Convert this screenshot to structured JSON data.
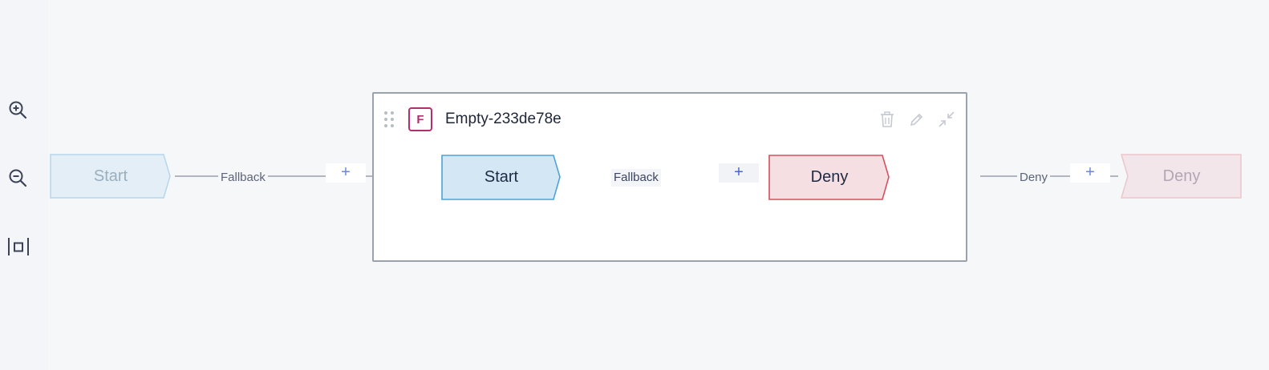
{
  "toolbar": {
    "zoom_in_icon": "zoom-in-icon",
    "zoom_out_icon": "zoom-out-icon",
    "fit_icon": "fit-to-screen-icon"
  },
  "outer_flow": {
    "start_label": "Start",
    "fallback_label": "Fallback",
    "add_label": "+",
    "deny_edge_label": "Deny",
    "add_label_right": "+",
    "deny_label": "Deny"
  },
  "group": {
    "badge": "F",
    "title": "Empty-233de78e",
    "delete_icon": "trash-icon",
    "edit_icon": "pencil-icon",
    "collapse_icon": "collapse-icon",
    "inner": {
      "start_label": "Start",
      "fallback_label": "Fallback",
      "add_label": "+",
      "deny_label": "Deny"
    }
  },
  "colors": {
    "start_fill": "#d3e7f5",
    "start_border": "#4ea3d6",
    "deny_fill": "#f5dfe3",
    "deny_border": "#d4505e",
    "badge": "#b0306d"
  }
}
